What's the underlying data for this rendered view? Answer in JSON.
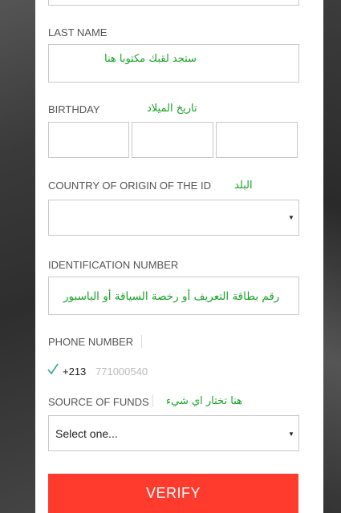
{
  "form": {
    "last_name_label": "LAST NAME",
    "last_name_hint": "ستجد لقبك مكتوبا هنا",
    "birthday_label": "BIRTHDAY",
    "birthday_hint": "تاريخ الميلاد",
    "country_label": "COUNTRY OF ORIGIN OF THE ID",
    "country_hint": "البلد",
    "country_value": "",
    "id_label": "IDENTIFICATION NUMBER",
    "id_hint": "رقم بطاقة التعريف أو رخصة السياقة أو الباسبور",
    "phone_label": "PHONE NUMBER",
    "phone_prefix": "+213",
    "phone_rest": "771000540",
    "funds_label": "SOURCE OF FUNDS",
    "funds_hint": "هنا تختار اي شيء",
    "funds_value": "Select one...",
    "verify_label": "VERIFY"
  },
  "colors": {
    "accent": "#ff3b2e",
    "hint_green": "#17a325",
    "check_green": "#2fa89a"
  },
  "icons": {
    "dropdown": "caret-down-icon",
    "valid": "checkmark-icon"
  }
}
